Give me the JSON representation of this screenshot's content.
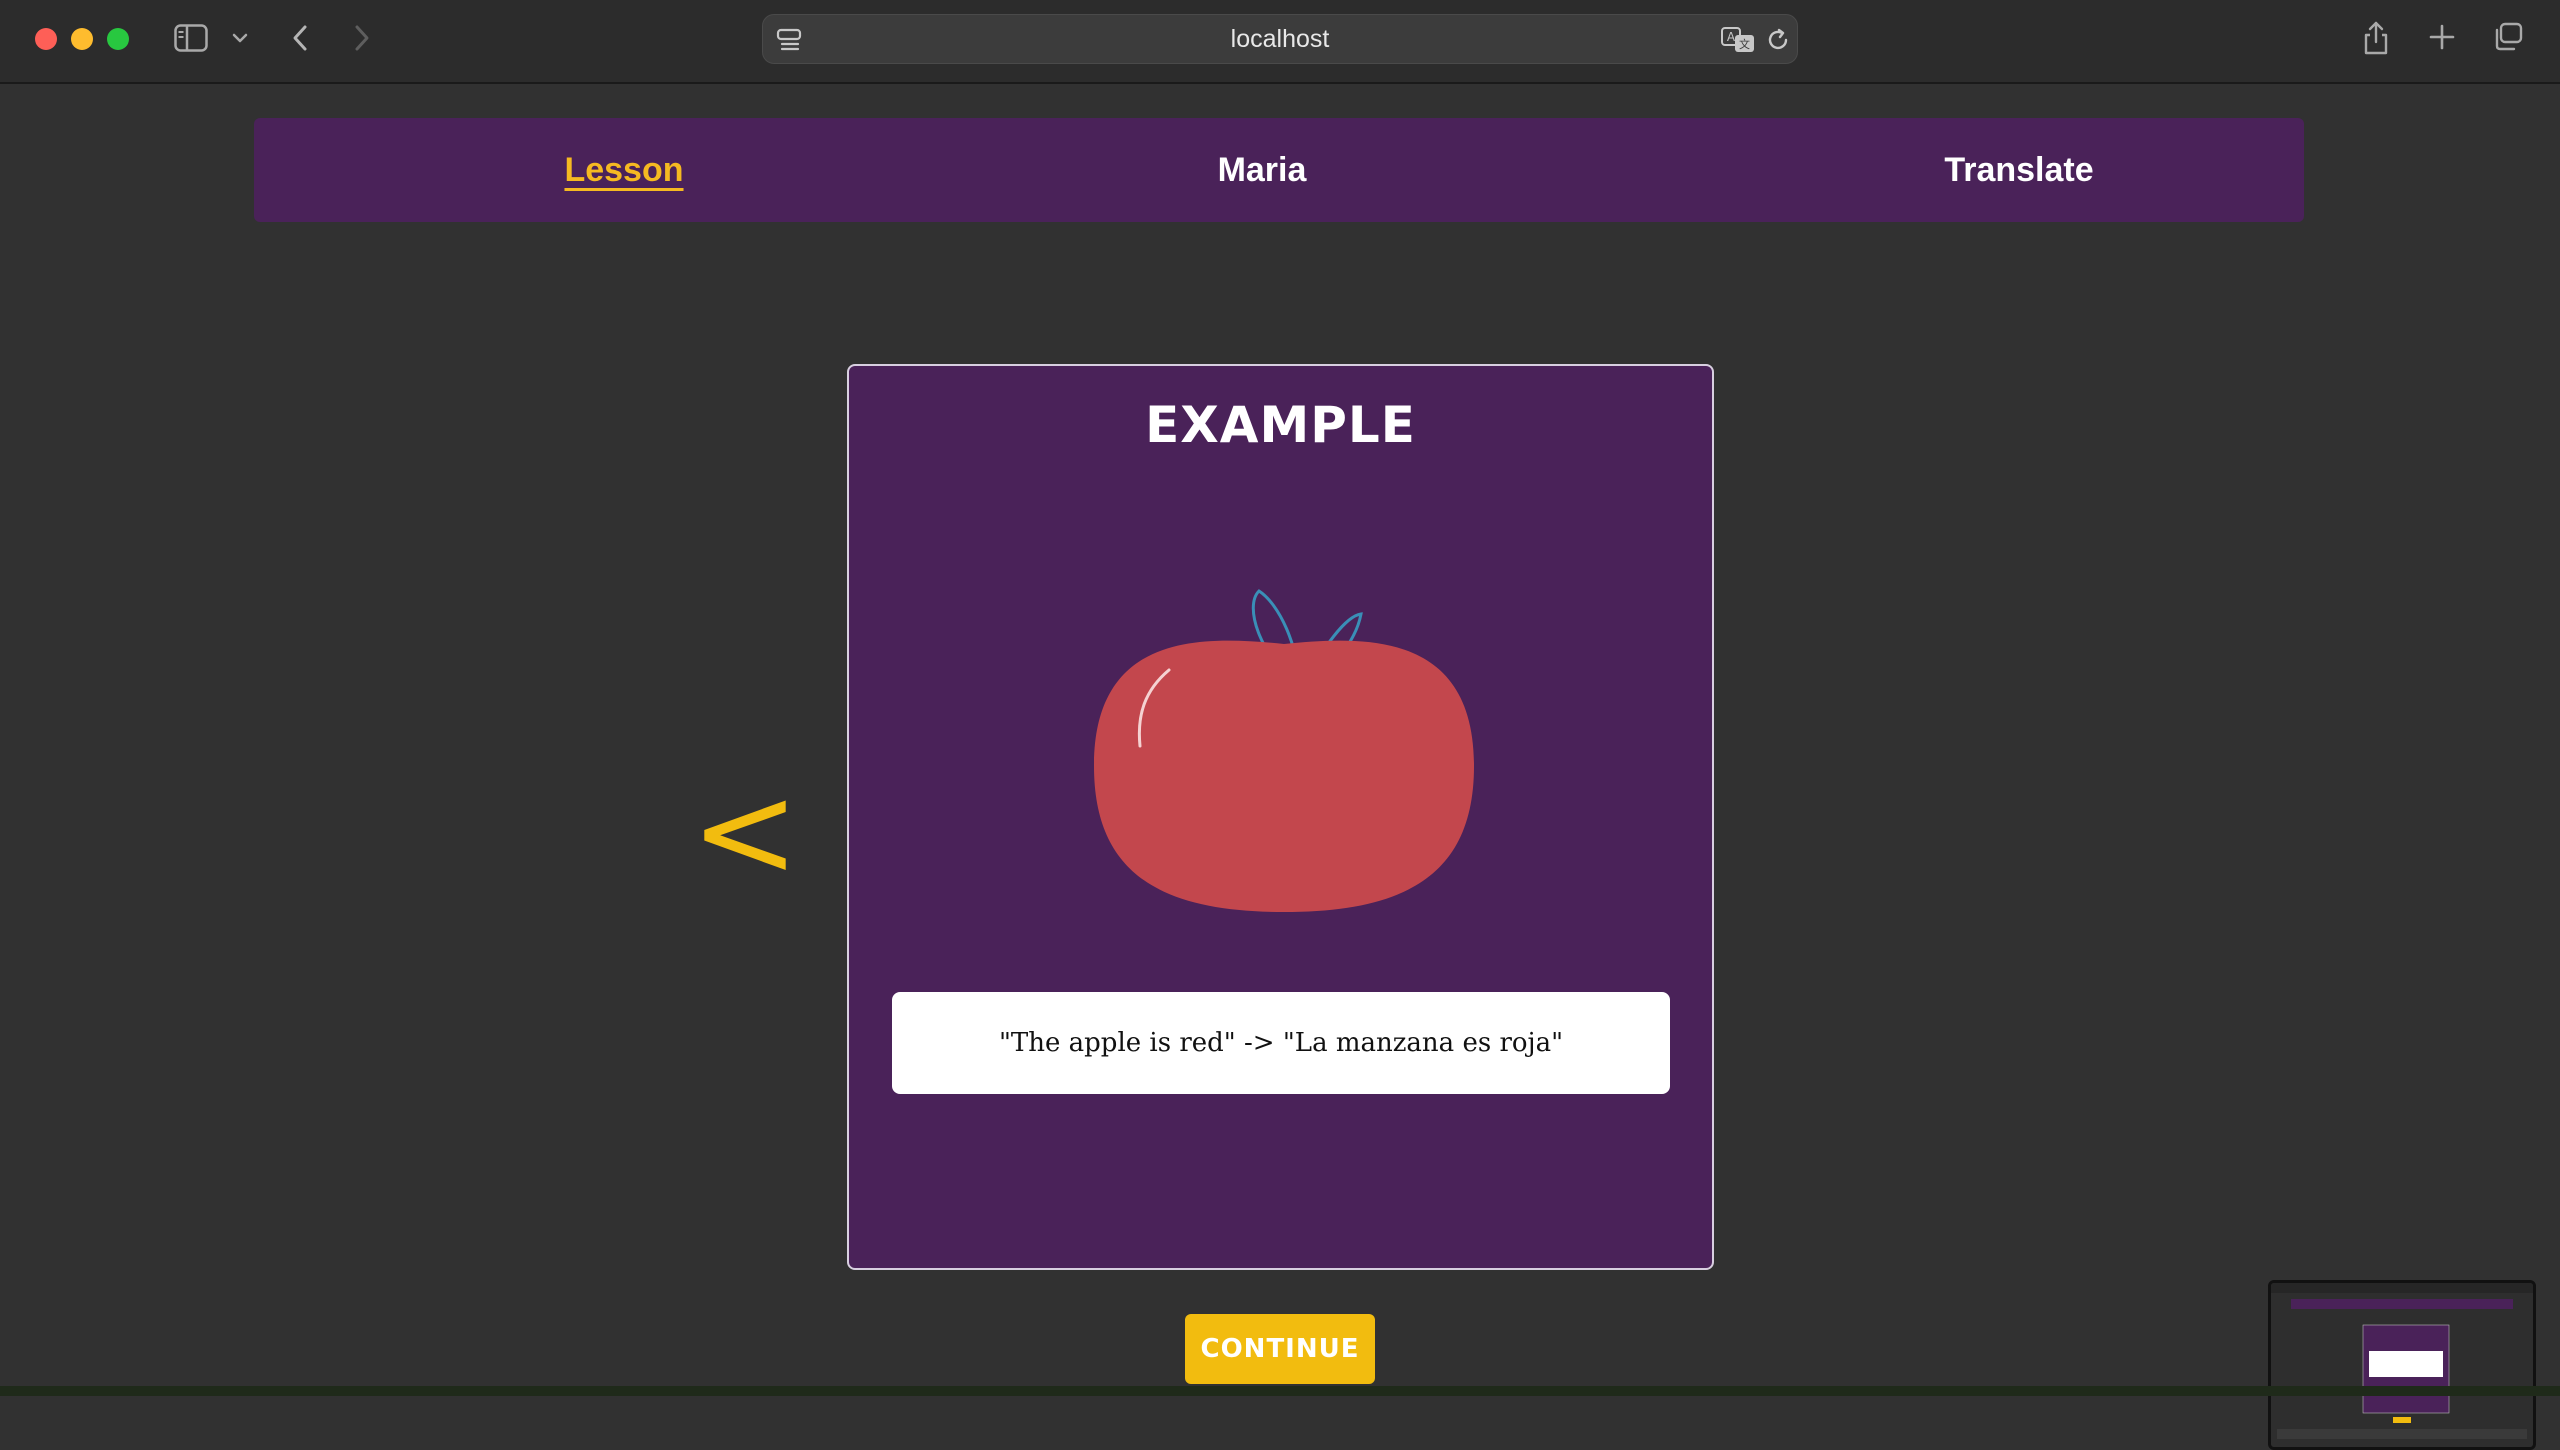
{
  "browser": {
    "url": "localhost"
  },
  "nav": {
    "items": [
      {
        "label": "Lesson",
        "active": true
      },
      {
        "label": "Maria",
        "active": false
      },
      {
        "label": "Translate",
        "active": false
      }
    ]
  },
  "lesson": {
    "prev_arrow": "<",
    "card_title": "EXAMPLE",
    "image": "apple",
    "sentence": "\"The apple is red\" -> \"La manzana es roja\"",
    "continue_label": "CONTINUE"
  },
  "colors": {
    "accent": "#f2bc0f",
    "panel": "#4a2259",
    "background": "#313131",
    "apple": "#c3474d",
    "leaf": "#3a8fb7"
  }
}
